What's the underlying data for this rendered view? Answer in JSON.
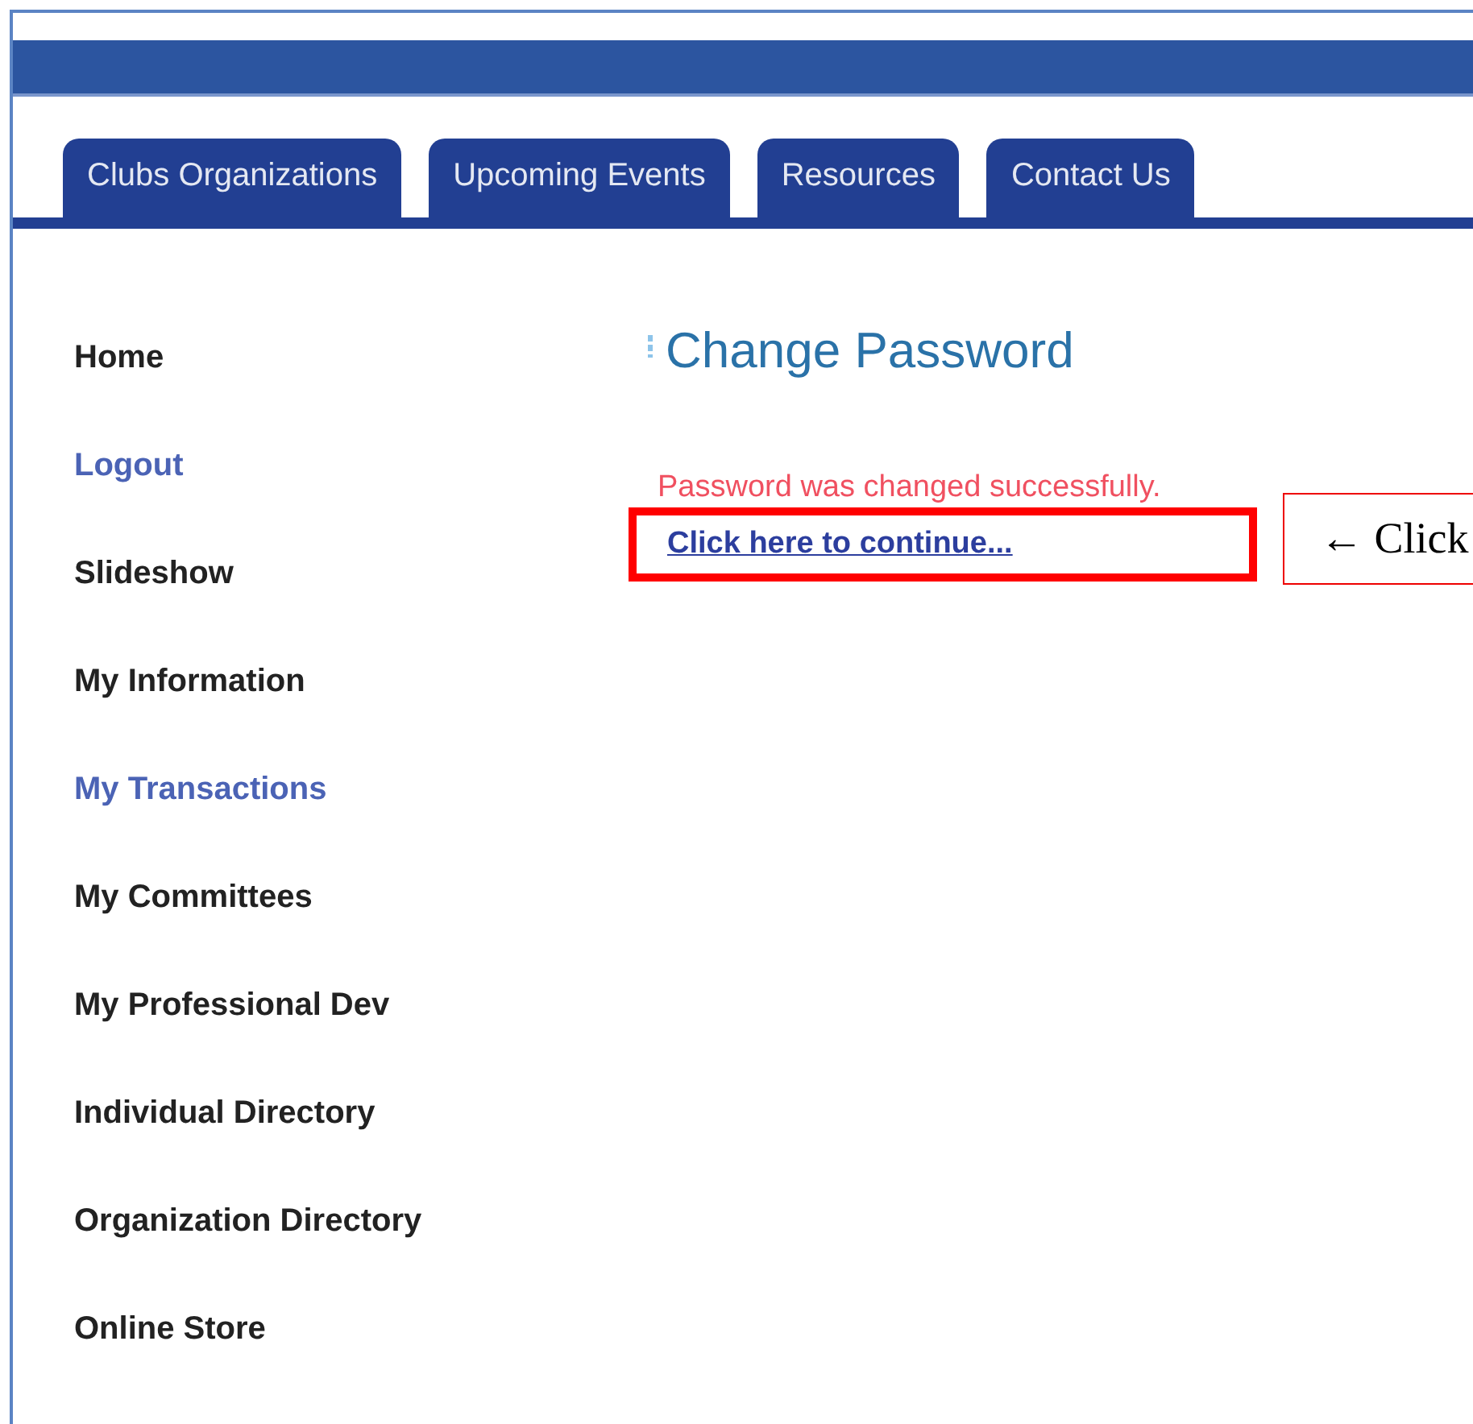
{
  "tabs": [
    {
      "label": "Clubs Organizations"
    },
    {
      "label": "Upcoming Events"
    },
    {
      "label": "Resources"
    },
    {
      "label": "Contact Us"
    }
  ],
  "sidebar": {
    "items": [
      {
        "label": "Home",
        "visited": false
      },
      {
        "label": "Logout",
        "visited": true
      },
      {
        "label": "Slideshow",
        "visited": false
      },
      {
        "label": "My Information",
        "visited": false
      },
      {
        "label": "My Transactions",
        "visited": true
      },
      {
        "label": "My Committees",
        "visited": false
      },
      {
        "label": "My Professional Dev",
        "visited": false
      },
      {
        "label": "Individual Directory",
        "visited": false
      },
      {
        "label": "Organization Directory",
        "visited": false
      },
      {
        "label": "Online Store",
        "visited": false
      }
    ]
  },
  "content": {
    "title": "Change Password",
    "message": "Password was changed successfully.",
    "link": "Click here to continue..."
  },
  "annotation": {
    "text": "← Click"
  }
}
